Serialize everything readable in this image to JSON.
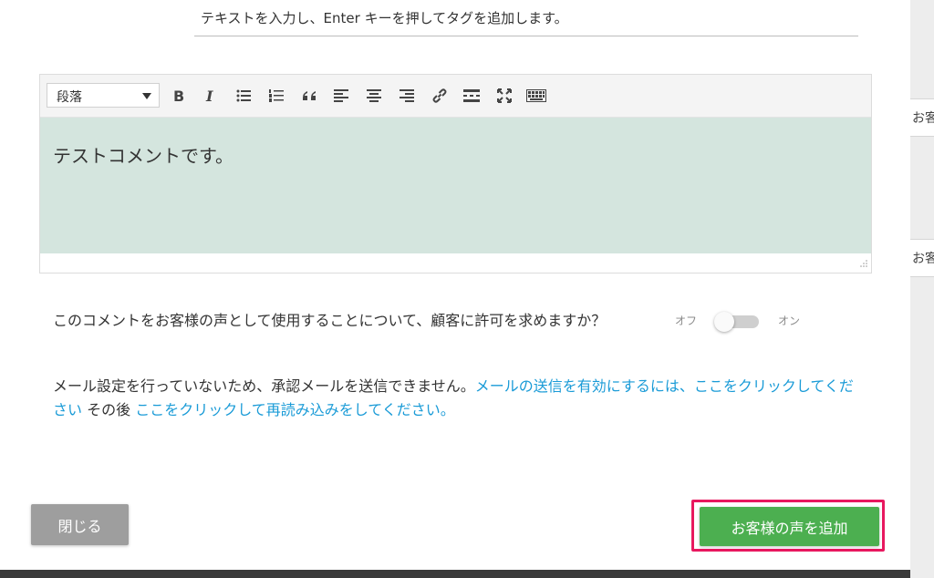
{
  "tags": {
    "hint": "テキストを入力し、Enter キーを押してタグを追加します。"
  },
  "editor": {
    "format_select": "段落",
    "toolbar_icons": [
      "bold-icon",
      "italic-icon",
      "bullet-list-icon",
      "numbered-list-icon",
      "blockquote-icon",
      "align-left-icon",
      "align-center-icon",
      "align-right-icon",
      "link-icon",
      "horizontal-rule-icon",
      "fullscreen-icon",
      "toolbar-toggle-icon"
    ],
    "content": "テストコメントです。",
    "content_bg": "#d4e5de"
  },
  "permission": {
    "question": "このコメントをお客様の声として使用することについて、顧客に許可を求めますか？",
    "toggle_off": "オフ",
    "toggle_on": "オン",
    "toggle_state": "off"
  },
  "email_notice": {
    "text1": "メール設定を行っていないため、承認メールを送信できません。",
    "link1": "メールの送信を有効にするには、ここをクリックしてください",
    "text2": " その後 ",
    "link2": "ここをクリックして再読み込みをしてください。"
  },
  "buttons": {
    "close": "閉じる",
    "add_testimonial": "お客様の声を追加"
  },
  "backdrop": {
    "fragment1": "お客",
    "fragment2": "お客"
  },
  "colors": {
    "link": "#1a9bd7",
    "primary_button": "#4caf50",
    "secondary_button": "#9e9e9e",
    "highlight": "#e8185f"
  }
}
